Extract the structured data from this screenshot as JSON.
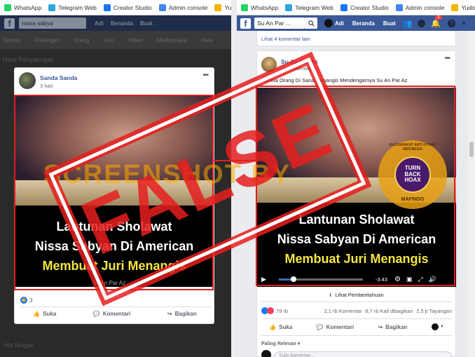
{
  "bookmarks": [
    {
      "label": "WhatsApp",
      "color": "#25d366"
    },
    {
      "label": "Telegram Web",
      "color": "#2ca5e0"
    },
    {
      "label": "Creator Studio",
      "color": "#1877f2"
    },
    {
      "label": "Admin console",
      "color": "#4285f4"
    },
    {
      "label": "Yudistira",
      "color": "#f4b400"
    }
  ],
  "left": {
    "search_value": "nissa sabya",
    "nav": [
      "Adi",
      "Beranda",
      "Buat"
    ],
    "filters": [
      "Semua",
      "Postingan",
      "Orang",
      "Foto",
      "Video",
      "Marketplace",
      "Hala"
    ],
    "side_title": "Hasil Penyaringan",
    "post": {
      "author": "Sanda Sanda",
      "time": "3 hari",
      "likes": "3",
      "actions": [
        "Suka",
        "Komentari",
        "Bagikan"
      ]
    },
    "sidebar_footer": "Hitt Tanggal"
  },
  "right": {
    "search_value": "Su An Par ...",
    "nav": [
      "Adi",
      "Beranda",
      "Buat"
    ],
    "notif_count": "1",
    "more_comments": "Lihat 4 komentar lain",
    "post": {
      "author": "Su An Par Az",
      "time": "20 September",
      "caption": "Semua Orang Di Sana Menangis Mendengarnya Su An Par Az",
      "time_remaining": "-3:43",
      "notif": "Lihat Pemberitahuan",
      "reactions": "79 rb",
      "comments": "2,1 rb Komentar",
      "shares": "8,7 rb Kali dibagikan",
      "views": "2,5 jt Tayangan",
      "actions": [
        "Suka",
        "Komentari",
        "Bagikan"
      ],
      "sort": "Paling Relevan",
      "comment_placeholder": "Tulis komentar..."
    }
  },
  "video": {
    "line1": "Lantunan Sholawat",
    "line2": "Nissa Sabyan Di American",
    "line3": "Membuat Juri Menangis",
    "channel": "Su An Par Az"
  },
  "overlay": {
    "screenshot_by": "SCREENSHOT BY",
    "stamp": "FALSE",
    "logo_ring": "MASYARAKAT ANTI FITNAH INDONESIA",
    "logo_center": "TURN BACK HOAX",
    "logo_bottom": "MAFINDO"
  }
}
